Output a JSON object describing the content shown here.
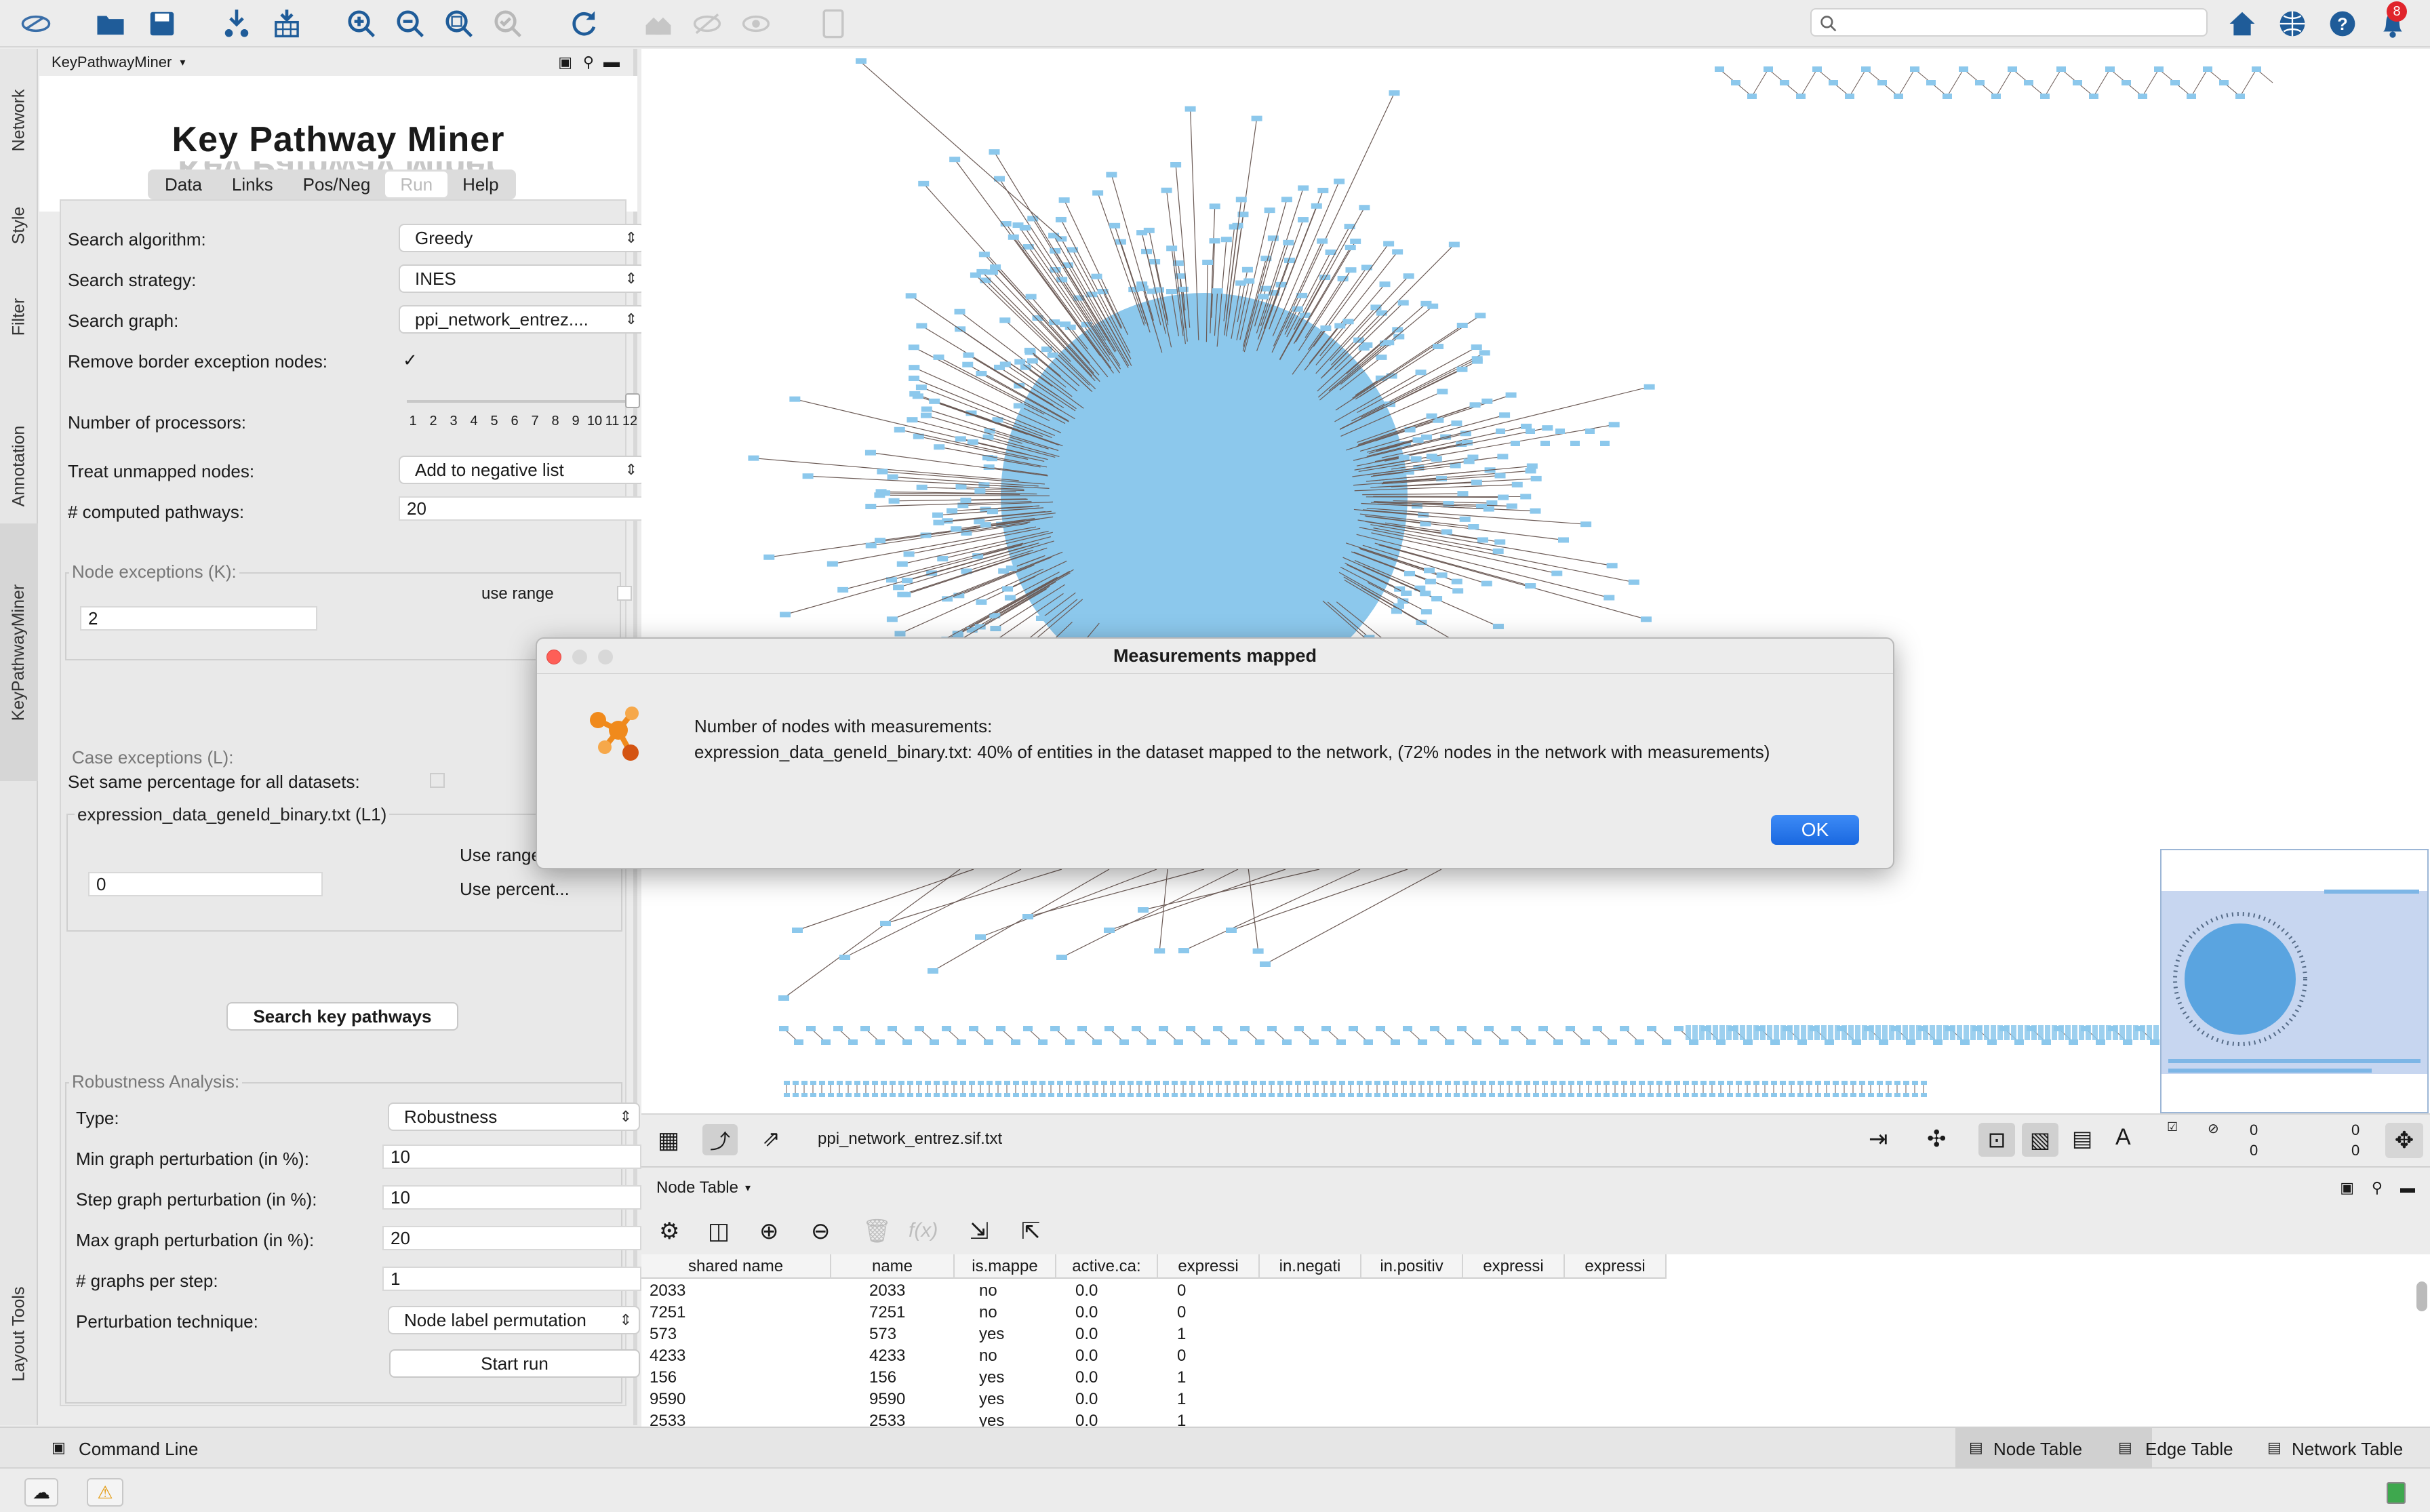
{
  "app": {
    "search_placeholder": "",
    "notifications": "8"
  },
  "leftstrip": {
    "tabs": [
      "Network",
      "Style",
      "Filter",
      "Annotation",
      "KeyPathwayMiner",
      "Layout Tools"
    ]
  },
  "panel": {
    "title": "KeyPathwayMiner",
    "logo_text": "Key Pathway Miner",
    "tabs": [
      "Data",
      "Links",
      "Pos/Neg",
      "Run",
      "Help"
    ],
    "search_algorithm_label": "Search algorithm:",
    "search_algorithm_value": "Greedy",
    "search_strategy_label": "Search strategy:",
    "search_strategy_value": "INES",
    "search_graph_label": "Search graph:",
    "search_graph_value": "ppi_network_entrez....",
    "remove_border_label": "Remove border exception nodes:",
    "remove_border_checked": "✓",
    "processors_label": "Number of processors:",
    "processor_ticks": [
      "1",
      "2",
      "3",
      "4",
      "5",
      "6",
      "7",
      "8",
      "9",
      "10",
      "11",
      "12"
    ],
    "processors_level": 1.0,
    "unmapped_label": "Treat unmapped nodes:",
    "unmapped_value": "Add to negative list",
    "computed_label": "# computed pathways:",
    "computed_value": "20",
    "node_exc_label": "Node exceptions (K):",
    "use_range_label": "use range",
    "node_exc_value": "2",
    "case_exc_label": "Case exceptions (L):",
    "same_pct_label": "Set same percentage for all datasets:",
    "dataset_label": "expression_data_geneId_binary.txt (L1)",
    "use_range2": "Use range",
    "use_percent": "Use percent...",
    "case_value": "0",
    "search_btn": "Search key pathways",
    "robust_label": "Robustness Analysis:",
    "type_label": "Type:",
    "type_value": "Robustness",
    "min_label": "Min graph perturbation (in %):",
    "min_value": "10",
    "step_label": "Step graph perturbation (in %):",
    "step_value": "10",
    "max_label": "Max graph perturbation (in %):",
    "max_value": "20",
    "graphs_label": "# graphs per step:",
    "graphs_value": "1",
    "tech_label": "Perturbation technique:",
    "tech_value": "Node label permutation",
    "start_btn": "Start run"
  },
  "network": {
    "name": "ppi_network_entrez.sif.txt",
    "counts": [
      "0",
      "0",
      "0",
      "0"
    ]
  },
  "nodetable": {
    "title": "Node Table",
    "columns": [
      "shared name",
      "name",
      "is.mappe",
      "active.ca:",
      "expressi",
      "in.negati",
      "in.positiv",
      "expressi",
      "expressi"
    ],
    "rows": [
      [
        "2033",
        "2033",
        "no",
        "0.0",
        "0"
      ],
      [
        "7251",
        "7251",
        "no",
        "0.0",
        "0"
      ],
      [
        "573",
        "573",
        "yes",
        "0.0",
        "1"
      ],
      [
        "4233",
        "4233",
        "no",
        "0.0",
        "0"
      ],
      [
        "156",
        "156",
        "yes",
        "0.0",
        "1"
      ],
      [
        "9590",
        "9590",
        "yes",
        "0.0",
        "1"
      ],
      [
        "2533",
        "2533",
        "yes",
        "0.0",
        "1"
      ]
    ]
  },
  "status": {
    "command_line": "Command Line",
    "tabs": [
      "Node Table",
      "Edge Table",
      "Network Table"
    ]
  },
  "dialog": {
    "title": "Measurements mapped",
    "line1": "Number of nodes with measurements:",
    "line2": "expression_data_geneId_binary.txt: 40% of entities in the dataset mapped to the network, (72% nodes in the network with measurements)",
    "ok": "OK"
  },
  "colors": {
    "node": "#8cc8ec",
    "edge": "#6b5a55",
    "accent": "#1a68e0"
  }
}
